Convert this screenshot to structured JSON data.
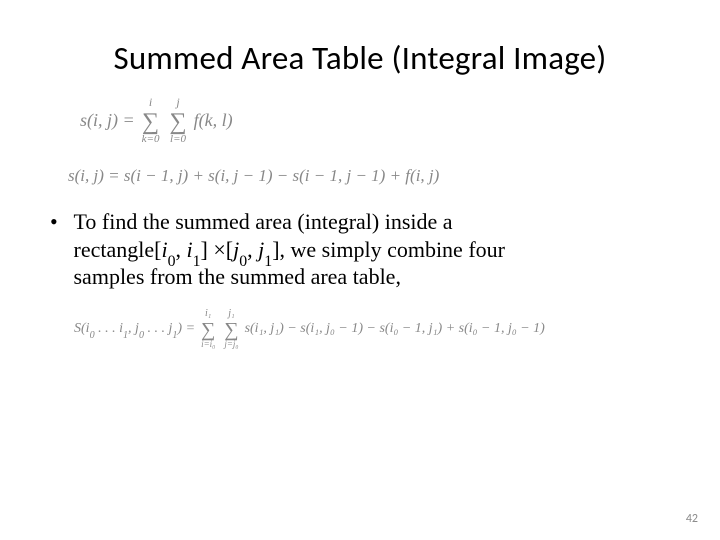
{
  "title": "Summed Area Table (Integral Image)",
  "eq1": {
    "lhs": "s(i, j) =",
    "sum1_top": "i",
    "sum1_bot": "k=0",
    "sum2_top": "j",
    "sum2_bot": "l=0",
    "rhs": "f(k, l)"
  },
  "eq2": "s(i, j) = s(i − 1, j) + s(i, j − 1) − s(i − 1, j − 1) + f(i, j)",
  "body": {
    "line1": "To find the summed area (integral) inside a",
    "line2a": "rectangle[",
    "i0": "i",
    "line2b": ", ",
    "i1": "i",
    "line2c": "] ×[",
    "j0": "j",
    "line2d": ", ",
    "j1": "j",
    "line2e": "], we simply combine four",
    "line3": "samples from the summed area table,"
  },
  "eq3": {
    "lhs_pre": "S(i",
    "lhs_mid1": " . . . i",
    "lhs_mid2": ", j",
    "lhs_mid3": " . . . j",
    "lhs_post": ") =",
    "sum1_top": "i₁",
    "sum1_bot": "i=i₀",
    "sum2_top": "j₁",
    "sum2_bot": "j=j₀",
    "t1": "s(i₁, j₁) − s(i₁, j₀ − 1) − s(i₀ − 1, j₁) + s(i₀ − 1, j₀ − 1)"
  },
  "pagenum": "42"
}
